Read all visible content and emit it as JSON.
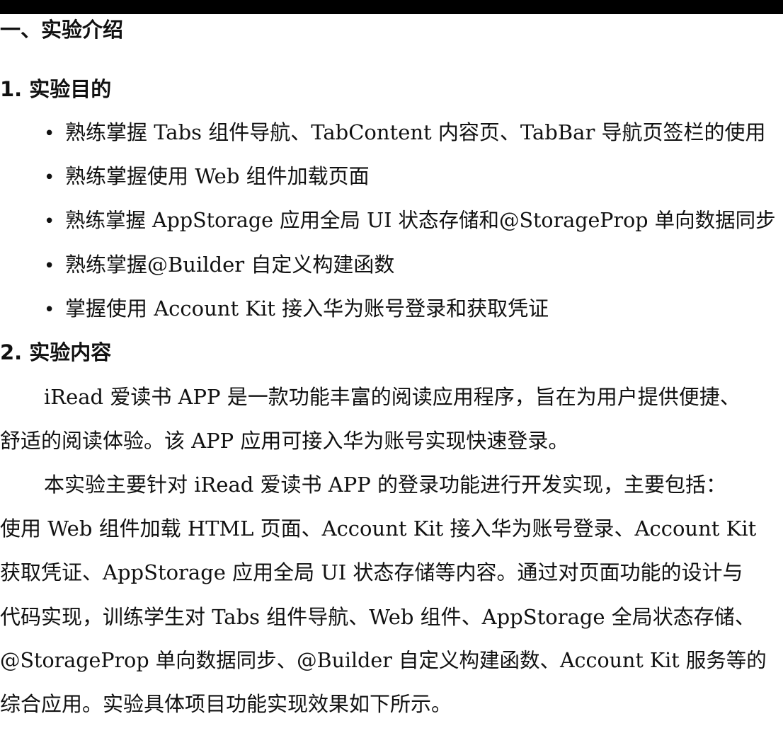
{
  "section_title": "一、实验介绍",
  "subsections": [
    {
      "title": "1. 实验目的",
      "bullets": [
        "熟练掌握 Tabs 组件导航、TabContent 内容页、TabBar 导航页签栏的使用",
        "熟练掌握使用 Web 组件加载页面",
        "熟练掌握 AppStorage 应用全局 UI 状态存储和@StorageProp 单向数据同步",
        "熟练掌握@Builder 自定义构建函数",
        "掌握使用 Account Kit 接入华为账号登录和获取凭证"
      ]
    },
    {
      "title": "2. 实验内容",
      "paragraphs": [
        {
          "lines": [
            "iRead 爱读书 APP 是一款功能丰富的阅读应用程序，旨在为用户提供便捷、",
            "舒适的阅读体验。该 APP 应用可接入华为账号实现快速登录。"
          ]
        },
        {
          "lines": [
            "本实验主要针对 iRead 爱读书 APP 的登录功能进行开发实现，主要包括：",
            "使用 Web 组件加载 HTML 页面、Account Kit 接入华为账号登录、Account Kit",
            "获取凭证、AppStorage 应用全局 UI 状态存储等内容。通过对页面功能的设计与",
            "代码实现，训练学生对 Tabs 组件导航、Web 组件、AppStorage 全局状态存储、",
            "@StorageProp 单向数据同步、@Builder 自定义构建函数、Account Kit 服务等的",
            "综合应用。实验具体项目功能实现效果如下所示。"
          ]
        }
      ]
    }
  ],
  "bullet_glyph": "•"
}
